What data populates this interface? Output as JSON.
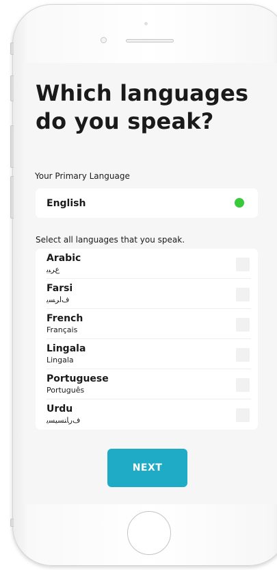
{
  "screen": {
    "title_line1": "Which languages",
    "title_line2": "do you speak?"
  },
  "primary": {
    "label": "Your Primary Language",
    "language": "English",
    "status_color": "#3ac93a"
  },
  "select": {
    "label": "Select all languages that you speak.",
    "items": [
      {
        "name": "Arabic",
        "native": "ﻉﺮﺒﻳ",
        "checked": false
      },
      {
        "name": "Farsi",
        "native": "ﻑﺍﺮﺴﻳ",
        "checked": false
      },
      {
        "name": "French",
        "native": "Français",
        "checked": false
      },
      {
        "name": "Lingala",
        "native": "Lingala",
        "checked": false
      },
      {
        "name": "Portuguese",
        "native": "Português",
        "checked": false
      },
      {
        "name": "Urdu",
        "native": "ﻑﺭﺎﻨﺴﻴﺴﻳ",
        "checked": false
      }
    ]
  },
  "next_button": {
    "label": "NEXT",
    "color": "#1fabc6"
  }
}
